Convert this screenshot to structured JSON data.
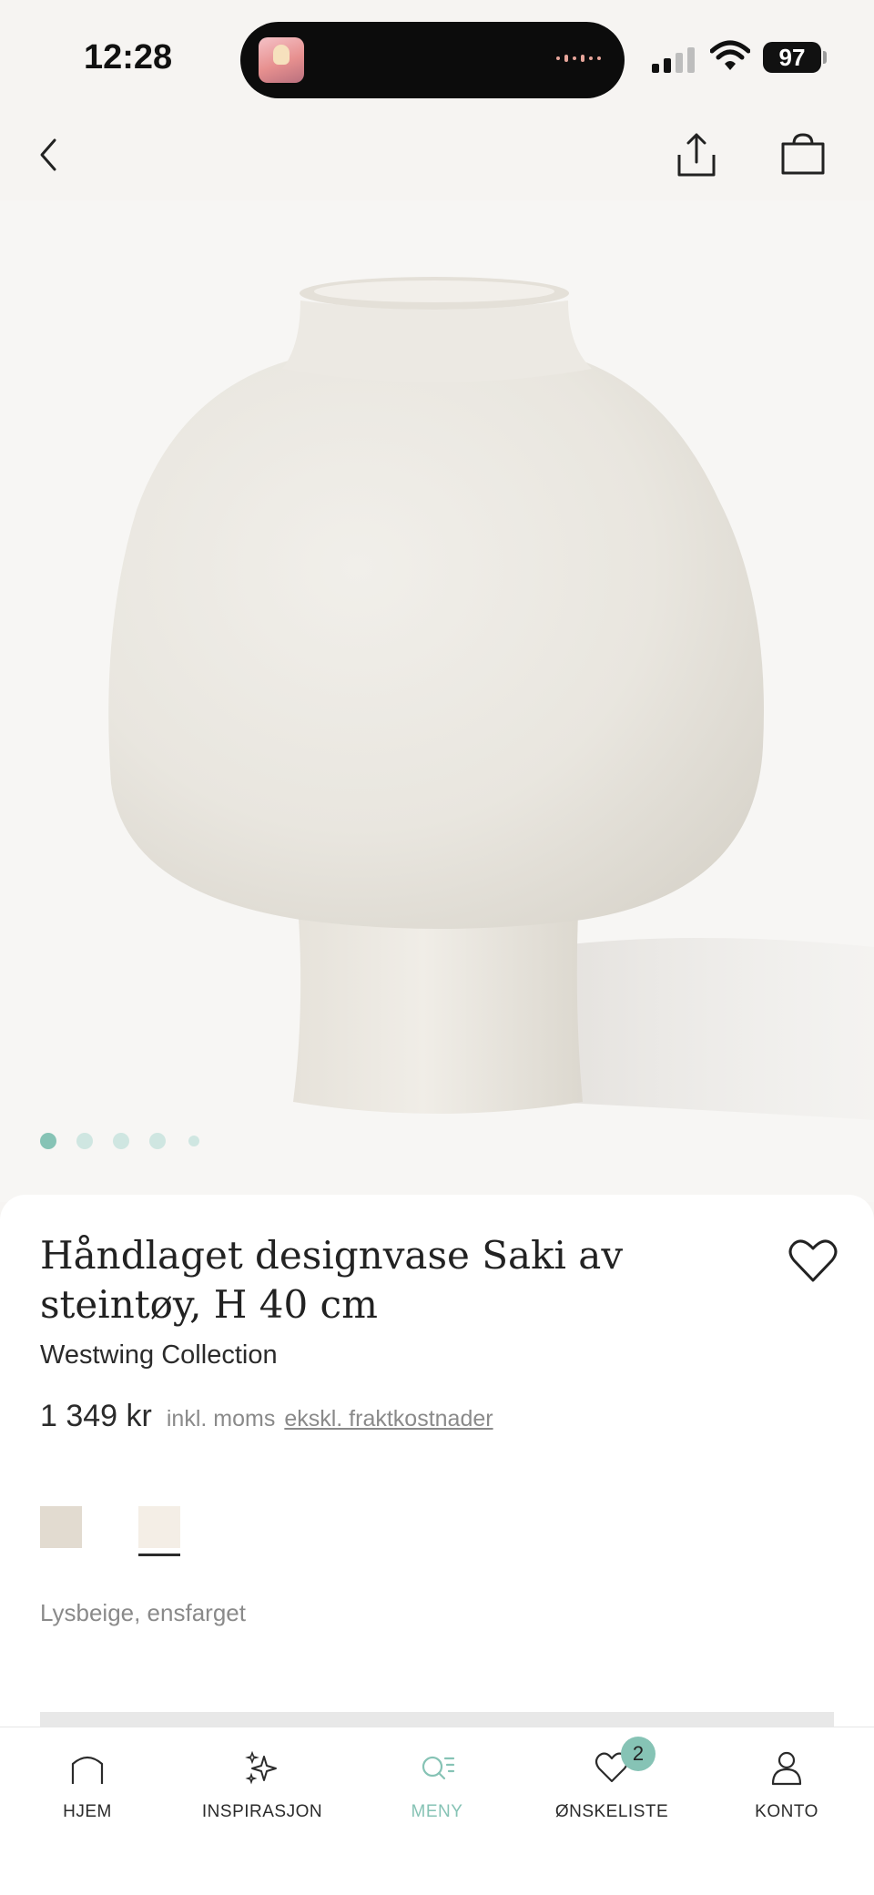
{
  "status_bar": {
    "time": "12:28",
    "battery": "97"
  },
  "header": {
    "back_icon": "chevron-left-icon",
    "share_icon": "share-icon",
    "bag_icon": "shopping-bag-icon"
  },
  "gallery": {
    "image_count": 5,
    "active_index": 0
  },
  "product": {
    "title": "Håndlaget designvase Saki av steintøy, H 40 cm",
    "brand": "Westwing Collection",
    "price": "1 349 kr",
    "vat_note": "inkl. moms",
    "shipping_link": "ekskl. fraktkostnader",
    "swatches": [
      {
        "color": "#e2dbd0"
      },
      {
        "color": "#f4eee6"
      }
    ],
    "selected_swatch": 1,
    "color_label": "Lysbeige, ensfarget"
  },
  "tabbar": {
    "tabs": [
      {
        "label": "HJEM",
        "icon": "home-icon"
      },
      {
        "label": "INSPIRASJON",
        "icon": "sparkles-icon"
      },
      {
        "label": "MENY",
        "icon": "search-menu-icon"
      },
      {
        "label": "ØNSKELISTE",
        "icon": "heart-icon",
        "badge": "2"
      },
      {
        "label": "KONTO",
        "icon": "user-icon"
      }
    ],
    "active_tab": 2
  },
  "colors": {
    "accent": "#86c3b5",
    "background": "#f6f4f2",
    "vase": "#efece6"
  }
}
